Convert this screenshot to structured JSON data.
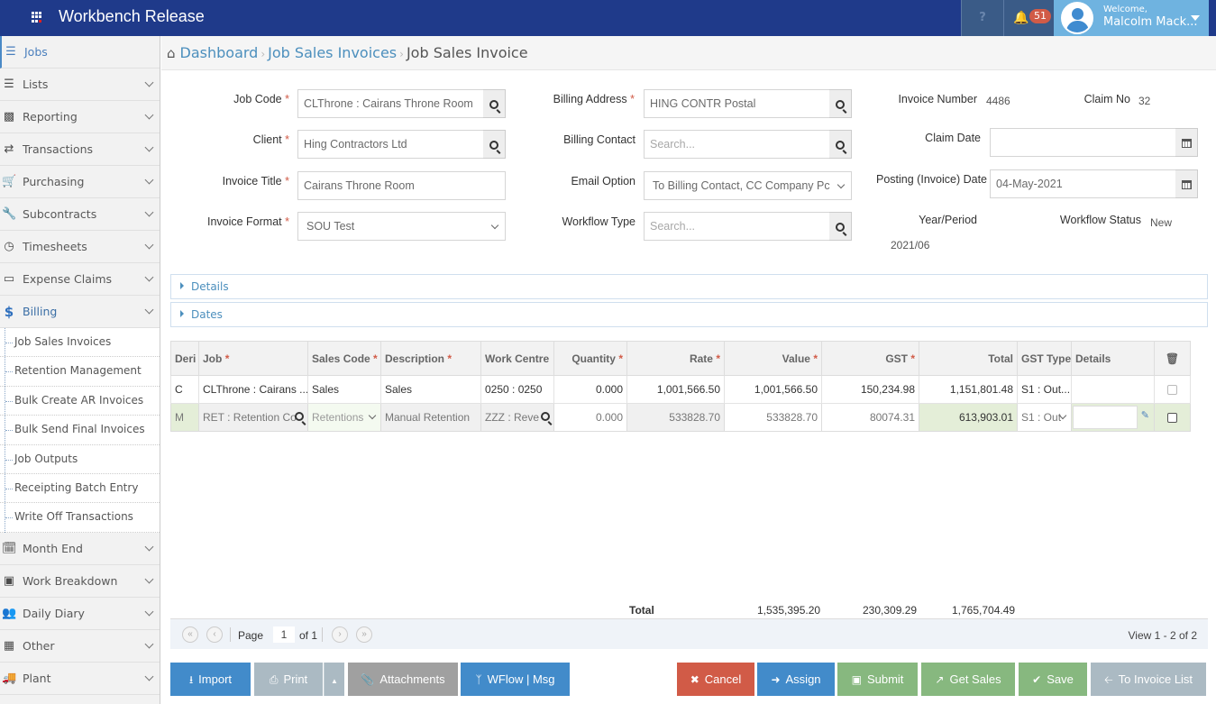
{
  "app": {
    "title": "Workbench Release"
  },
  "header": {
    "help_label": "?",
    "notifications_count": "51",
    "welcome": "Welcome,",
    "username": "Malcolm Mack..."
  },
  "sidebar": {
    "items_top": [
      {
        "label": "Jobs",
        "icon": "jobs-icon"
      },
      {
        "label": "Lists",
        "icon": "list-icon"
      },
      {
        "label": "Reporting",
        "icon": "bar-chart-icon"
      },
      {
        "label": "Transactions",
        "icon": "exchange-icon"
      },
      {
        "label": "Purchasing",
        "icon": "cart-icon"
      },
      {
        "label": "Subcontracts",
        "icon": "wrench-icon"
      },
      {
        "label": "Timesheets",
        "icon": "clock-icon"
      },
      {
        "label": "Expense Claims",
        "icon": "credit-card-icon"
      },
      {
        "label": "Billing",
        "icon": "dollar-icon"
      }
    ],
    "billing_sub": [
      "Job Sales Invoices",
      "Retention Management",
      "Bulk Create AR Invoices",
      "Bulk Send Final Invoices",
      "Job Outputs",
      "Receipting Batch Entry",
      "Write Off Transactions"
    ],
    "items_bottom": [
      {
        "label": "Month End",
        "icon": "calendar-x-icon"
      },
      {
        "label": "Work Breakdown",
        "icon": "puzzle-icon"
      },
      {
        "label": "Daily Diary",
        "icon": "users-icon"
      },
      {
        "label": "Other",
        "icon": "grid-icon"
      },
      {
        "label": "Plant",
        "icon": "truck-icon"
      }
    ]
  },
  "breadcrumb": {
    "items": [
      "Dashboard",
      "Job Sales Invoices"
    ],
    "current": "Job Sales Invoice"
  },
  "form": {
    "job_code": {
      "label": "Job Code",
      "value": "CLThrone : Cairans Throne Room"
    },
    "client": {
      "label": "Client",
      "value": "Hing Contractors Ltd"
    },
    "invoice_title": {
      "label": "Invoice Title",
      "value": "Cairans Throne Room"
    },
    "invoice_format": {
      "label": "Invoice Format",
      "value": "SOU Test"
    },
    "billing_address": {
      "label": "Billing Address",
      "value": "HING CONTR Postal"
    },
    "billing_contact": {
      "label": "Billing Contact",
      "placeholder": "Search..."
    },
    "email_option": {
      "label": "Email Option",
      "value": "To Billing Contact, CC Company Pc"
    },
    "workflow_type": {
      "label": "Workflow Type",
      "placeholder": "Search..."
    },
    "invoice_number": {
      "label": "Invoice Number",
      "value": "4486"
    },
    "claim_no": {
      "label": "Claim No",
      "value": "32"
    },
    "claim_date": {
      "label": "Claim Date",
      "value": ""
    },
    "posting_date": {
      "label": "Posting (Invoice) Date",
      "value": "04-May-2021"
    },
    "year_period": {
      "label": "Year/Period",
      "value": "2021/06"
    },
    "workflow_status": {
      "label": "Workflow Status",
      "value": "New"
    }
  },
  "sections": {
    "details": "Details",
    "dates": "Dates"
  },
  "grid": {
    "columns": [
      "Deri",
      "Job",
      "Sales Code",
      "Description",
      "Work Centre",
      "Quantity",
      "Rate",
      "Value",
      "GST",
      "Total",
      "GST Type",
      "Details"
    ],
    "rows": [
      {
        "deri": "C",
        "job": "CLThrone : Cairans ...",
        "sales_code": "Sales",
        "description": "Sales",
        "work_centre": "0250 : 0250",
        "quantity": "0.000",
        "rate": "1,001,566.50",
        "value": "1,001,566.50",
        "gst": "150,234.98",
        "total": "1,151,801.48",
        "gst_type": "S1 : Out...",
        "details": ""
      },
      {
        "deri": "M",
        "job": "RET : Retention Co",
        "sales_code": "Retentions",
        "description": "Manual Retention",
        "work_centre": "ZZZ : Reve",
        "quantity": "0.000",
        "rate": "533828.70",
        "value": "533828.70",
        "gst": "80074.31",
        "total": "613,903.01",
        "gst_type": "S1 : Out",
        "details": ""
      }
    ],
    "totals": {
      "label": "Total",
      "value": "1,535,395.20",
      "gst": "230,309.29",
      "total": "1,765,704.49"
    }
  },
  "pager": {
    "page_label": "Page",
    "page": "1",
    "of_label": "of 1",
    "view": "View 1 - 2 of 2"
  },
  "buttons": {
    "import": "Import",
    "print": "Print",
    "attachments": "Attachments",
    "wflow": "WFlow | Msg",
    "cancel": "Cancel",
    "assign": "Assign",
    "submit": "Submit",
    "get_sales": "Get Sales",
    "save": "Save",
    "to_invoice_list": "To Invoice List"
  }
}
